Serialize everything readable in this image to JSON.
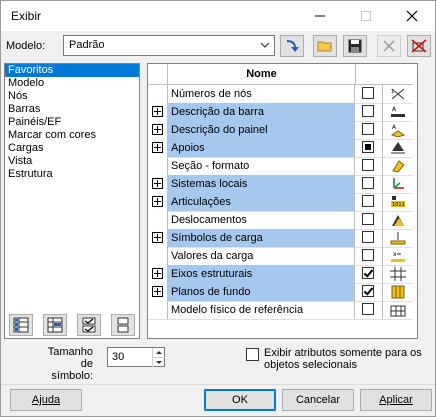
{
  "window": {
    "title": "Exibir"
  },
  "titlebar": {
    "minimize_icon": "minimize-icon",
    "maximize_icon": "maximize-icon",
    "close_icon": "close-icon"
  },
  "model": {
    "label": "Modelo:",
    "selected": "Padrão",
    "toolbar_icons": [
      "apply-model-icon",
      "open-folder-icon",
      "save-icon",
      "delete-icon",
      "reset-icon"
    ]
  },
  "categories": {
    "items": [
      "Favoritos",
      "Modelo",
      "Nós",
      "Barras",
      "Painéis/EF",
      "Marcar com cores",
      "Cargas",
      "Vista",
      "Estrutura"
    ],
    "selected_index": 0
  },
  "grid": {
    "header_name": "Nome",
    "rows": [
      {
        "name": "Números de nós",
        "expandable": false,
        "highlighted": false,
        "check": "off",
        "icon": "node-numbers-icon"
      },
      {
        "name": "Descrição da barra",
        "expandable": true,
        "highlighted": true,
        "check": "off",
        "icon": "bar-description-icon"
      },
      {
        "name": "Descrição do painel",
        "expandable": true,
        "highlighted": true,
        "check": "off",
        "icon": "panel-description-icon"
      },
      {
        "name": "Apoios",
        "expandable": true,
        "highlighted": true,
        "check": "mixed",
        "icon": "supports-icon"
      },
      {
        "name": "Seção - formato",
        "expandable": false,
        "highlighted": false,
        "check": "off",
        "icon": "section-shape-icon"
      },
      {
        "name": "Sistemas locais",
        "expandable": true,
        "highlighted": true,
        "check": "off",
        "icon": "local-systems-icon"
      },
      {
        "name": "Articulações",
        "expandable": true,
        "highlighted": true,
        "check": "off",
        "icon": "releases-icon"
      },
      {
        "name": "Deslocamentos",
        "expandable": false,
        "highlighted": false,
        "check": "off",
        "icon": "offsets-icon"
      },
      {
        "name": "Símbolos de carga",
        "expandable": true,
        "highlighted": true,
        "check": "off",
        "icon": "load-symbols-icon"
      },
      {
        "name": "Valores da carga",
        "expandable": false,
        "highlighted": false,
        "check": "off",
        "icon": "load-values-icon"
      },
      {
        "name": "Eixos estruturais",
        "expandable": true,
        "highlighted": true,
        "check": "on",
        "icon": "structural-axes-icon"
      },
      {
        "name": "Planos de fundo",
        "expandable": true,
        "highlighted": true,
        "check": "on",
        "icon": "background-planes-icon"
      },
      {
        "name": "Modelo físico de referência",
        "expandable": false,
        "highlighted": false,
        "check": "off",
        "icon": "physical-model-icon"
      }
    ]
  },
  "list_buttons": [
    "select-all-icon",
    "deselect-all-icon",
    "check-selected-icon",
    "uncheck-icon"
  ],
  "symbol_size": {
    "label_line1": "Tamanho de",
    "label_line2": "símbolo:",
    "value": "30"
  },
  "only_selected": {
    "label_line1": "Exibir atributos somente para os",
    "label_line2": "objetos selecionais",
    "checked": false
  },
  "buttons": {
    "help": "Ajuda",
    "ok": "OK",
    "cancel": "Cancelar",
    "apply": "Aplicar"
  }
}
